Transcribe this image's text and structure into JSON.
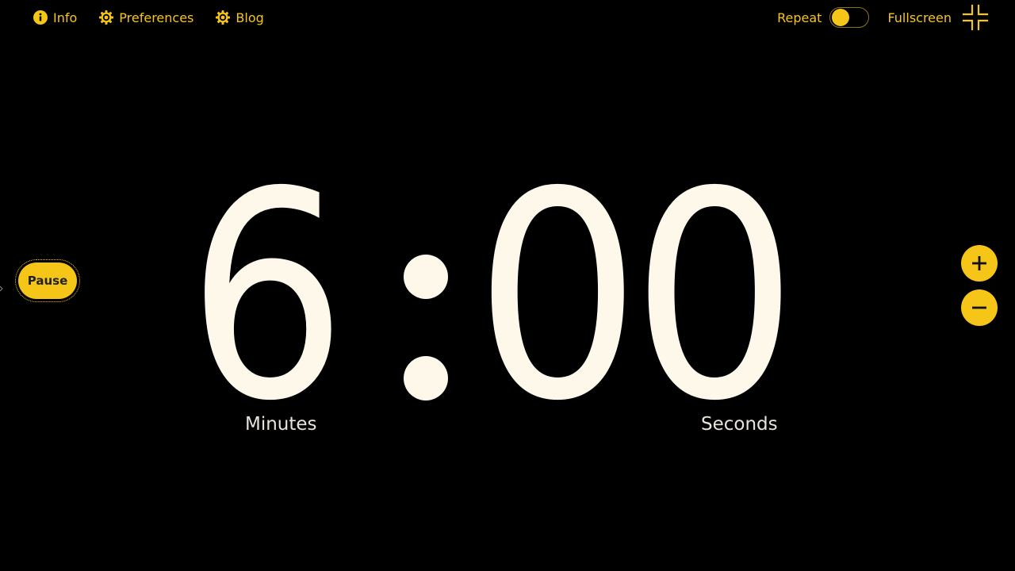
{
  "nav": {
    "info_label": "Info",
    "preferences_label": "Preferences",
    "blog_label": "Blog",
    "repeat_label": "Repeat",
    "repeat_enabled": false,
    "fullscreen_label": "Fullscreen"
  },
  "controls": {
    "pause_label": "Pause"
  },
  "timer": {
    "minutes": "6",
    "seconds": "00",
    "minutes_label": "Minutes",
    "seconds_label": "Seconds"
  },
  "colors": {
    "accent": "#f5c518",
    "digit": "#fdf8ea",
    "background": "#000000"
  },
  "icons": {
    "info": "info-icon",
    "preferences": "gear-icon",
    "blog": "gear-icon",
    "fullscreen": "exit-fullscreen-icon",
    "increase": "plus-icon",
    "decrease": "minus-icon"
  }
}
